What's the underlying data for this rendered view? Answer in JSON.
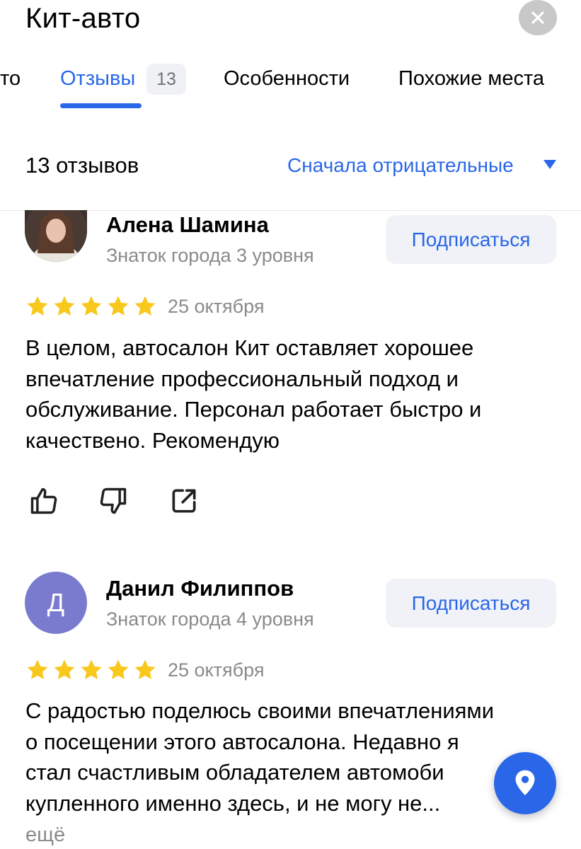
{
  "header": {
    "title": "Кит-авто"
  },
  "tabs": [
    {
      "label": "то"
    },
    {
      "label": "Отзывы",
      "count": "13",
      "active": true
    },
    {
      "label": "Особенности"
    },
    {
      "label": "Похожие места"
    }
  ],
  "reviews_header": {
    "count_label": "13 отзывов",
    "sort_label": "Сначала отрицательные"
  },
  "reviews": [
    {
      "name": "Алена Шамина",
      "level": "Знаток города 3 уровня",
      "subscribe_label": "Подписаться",
      "rating": 5,
      "date": "25 октября",
      "text": "В целом, автосалон Кит оставляет хорошее впечатление профессиональный подход и обслуживание. Персонал работает быстро и качествено. Рекомендую",
      "avatar": "photo"
    },
    {
      "name": "Данил Филиппов",
      "level": "Знаток города 4 уровня",
      "subscribe_label": "Подписаться",
      "rating": 5,
      "date": "25 октября",
      "avatar_letter": "Д",
      "text_lines": [
        "С радостью поделюсь своими впечатлениями",
        "о посещении этого автосалона. Недавно я",
        "стал счастливым обладателем автомоби",
        "купленного именно здесь, и не могу не..."
      ],
      "more_label": "ещё"
    }
  ],
  "colors": {
    "accent": "#2a67e8",
    "star": "#f8c81c",
    "avatar_letter_bg": "#7a7bcf"
  },
  "icons": [
    "close-icon",
    "star-icon",
    "thumbs-up-icon",
    "thumbs-down-icon",
    "share-icon",
    "map-pin-icon"
  ]
}
